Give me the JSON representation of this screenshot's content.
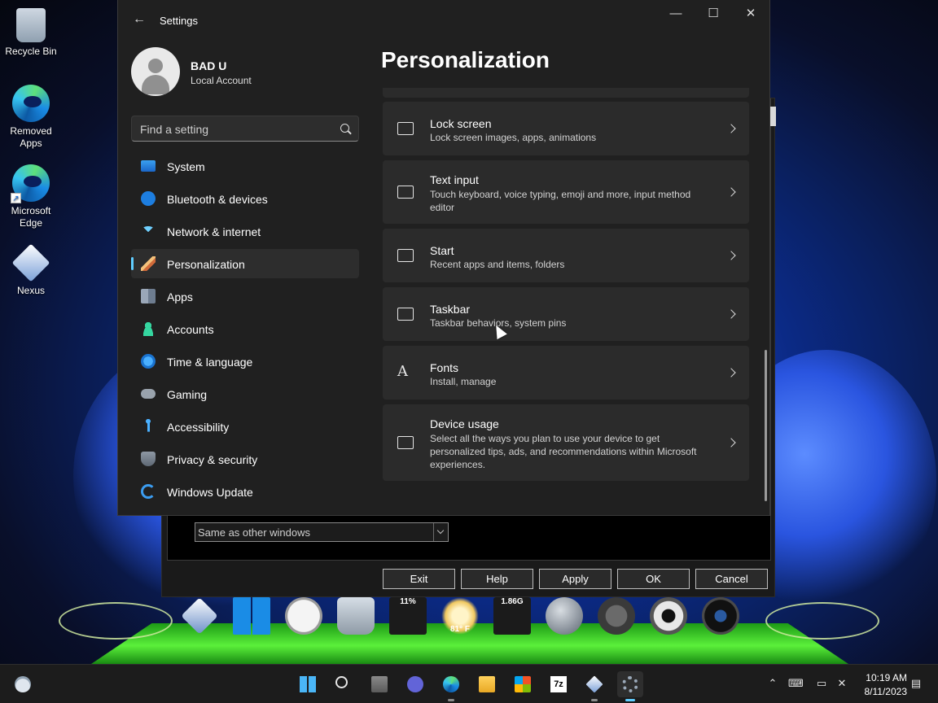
{
  "desktop": {
    "icons": [
      {
        "label": "Recycle Bin"
      },
      {
        "label": "Removed Apps"
      },
      {
        "label": "Microsoft Edge"
      },
      {
        "label": "Nexus"
      }
    ]
  },
  "settings": {
    "app_title": "Settings",
    "user": {
      "name": "BAD U",
      "account_type": "Local Account"
    },
    "search": {
      "placeholder": "Find a setting"
    },
    "nav": [
      {
        "label": "System",
        "icon": "system-icon"
      },
      {
        "label": "Bluetooth & devices",
        "icon": "bluetooth-icon"
      },
      {
        "label": "Network & internet",
        "icon": "wifi-icon"
      },
      {
        "label": "Personalization",
        "icon": "brush-icon",
        "selected": true
      },
      {
        "label": "Apps",
        "icon": "apps-icon"
      },
      {
        "label": "Accounts",
        "icon": "person-icon"
      },
      {
        "label": "Time & language",
        "icon": "globe-clock-icon"
      },
      {
        "label": "Gaming",
        "icon": "gamepad-icon"
      },
      {
        "label": "Accessibility",
        "icon": "accessibility-icon"
      },
      {
        "label": "Privacy & security",
        "icon": "shield-icon"
      },
      {
        "label": "Windows Update",
        "icon": "update-icon"
      }
    ],
    "page_title": "Personalization",
    "cards": [
      {
        "title": "Lock screen",
        "desc": "Lock screen images, apps, animations",
        "icon": "lock-screen-icon"
      },
      {
        "title": "Text input",
        "desc": "Touch keyboard, voice typing, emoji and more, input method editor",
        "icon": "keyboard-icon"
      },
      {
        "title": "Start",
        "desc": "Recent apps and items, folders",
        "icon": "start-icon"
      },
      {
        "title": "Taskbar",
        "desc": "Taskbar behaviors, system pins",
        "icon": "taskbar-icon"
      },
      {
        "title": "Fonts",
        "desc": "Install, manage",
        "icon": "fonts-icon"
      },
      {
        "title": "Device usage",
        "desc": "Select all the ways you plan to use your device to get personalized tips, ads, and recommendations within Microsoft experiences.",
        "icon": "device-usage-icon"
      }
    ]
  },
  "dialog": {
    "dropdown_value": "Same as other windows",
    "buttons": {
      "exit": "Exit",
      "help": "Help",
      "apply": "Apply",
      "ok": "OK",
      "cancel": "Cancel"
    }
  },
  "dock": {
    "cpu_label": "11%",
    "weather_label": "81° F",
    "memory_label": "1.86G"
  },
  "tray": {
    "time": "10:19 AM",
    "date": "8/11/2023"
  }
}
